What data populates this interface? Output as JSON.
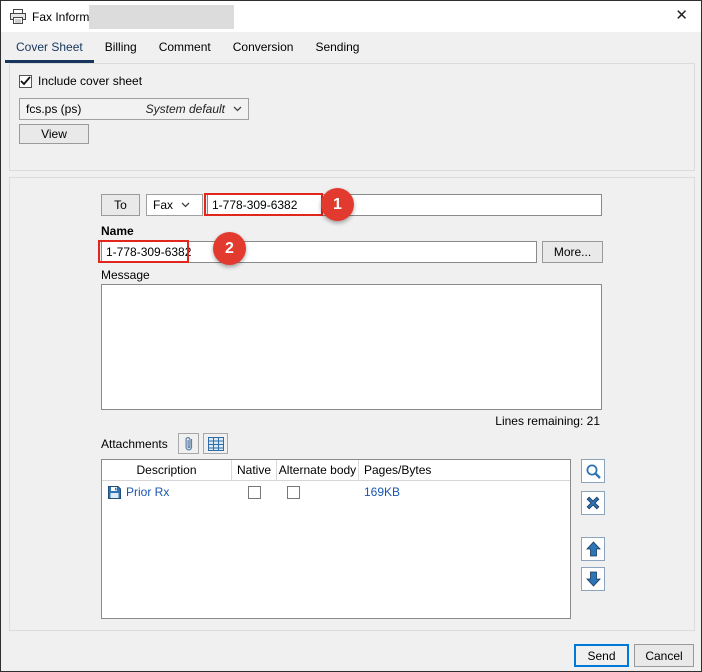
{
  "window": {
    "title": "Fax Information",
    "close_glyph": "✕"
  },
  "tabs": [
    {
      "label": "Cover Sheet"
    },
    {
      "label": "Billing"
    },
    {
      "label": "Comment"
    },
    {
      "label": "Conversion"
    },
    {
      "label": "Sending"
    }
  ],
  "cover_sheet": {
    "include_label": "Include cover sheet",
    "include_checked": true,
    "file_value": "fcs.ps (ps)",
    "file_mode": "System default",
    "view_button": "View"
  },
  "recipient": {
    "to_button": "To",
    "dest_type": "Fax",
    "fax_number": "1-778-309-6382",
    "name_label": "Name",
    "name_value": "1-778-309-6382",
    "more_button": "More...",
    "message_label": "Message",
    "message_value": "",
    "lines_remaining": "Lines remaining: 21"
  },
  "attachments": {
    "label": "Attachments",
    "headers": [
      "Description",
      "Native",
      "Alternate body",
      "Pages/Bytes"
    ],
    "rows": [
      {
        "description": "Prior Rx",
        "native_checked": false,
        "alternate_checked": false,
        "pages_bytes": "169KB"
      }
    ]
  },
  "annotations": {
    "callout1": "1",
    "callout2": "2"
  },
  "footer": {
    "send_button": "Send",
    "cancel_button": "Cancel"
  },
  "colors": {
    "annotation_red": "#e0261d",
    "tab_accent": "#17365d",
    "icon_blue": "#2e75b6",
    "link_blue": "#1b57b1",
    "focus_blue": "#0078d7"
  }
}
